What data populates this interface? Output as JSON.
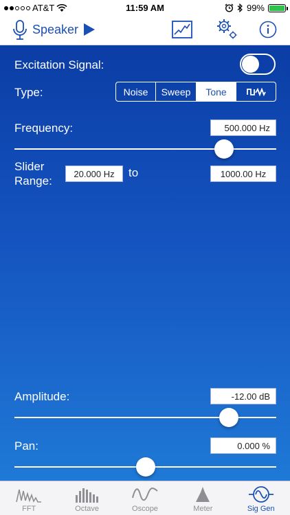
{
  "status_bar": {
    "carrier": "AT&T",
    "signal_dots_filled": 2,
    "signal_dots_total": 5,
    "time": "11:59 AM",
    "battery_percent_label": "99%",
    "battery_level": 0.99
  },
  "toolbar": {
    "input_label": "Speaker",
    "icons": [
      "microphone-icon",
      "play-icon",
      "chart-icon",
      "settings-icon",
      "info-icon"
    ]
  },
  "excitation": {
    "label": "Excitation Signal:",
    "enabled": false
  },
  "type": {
    "label": "Type:",
    "options": [
      "Noise",
      "Sweep",
      "Tone",
      "square-wave-icon"
    ],
    "selected": "Tone"
  },
  "frequency": {
    "label": "Frequency:",
    "value": "500.000 Hz",
    "slider_fraction": 0.8
  },
  "slider_range": {
    "label_line1": "Slider",
    "label_line2": "Range:",
    "min": "20.000 Hz",
    "to_label": "to",
    "max": "1000.00 Hz"
  },
  "amplitude": {
    "label": "Amplitude:",
    "value": "-12.00 dB",
    "slider_fraction": 0.82
  },
  "pan": {
    "label": "Pan:",
    "value": "0.000 %",
    "slider_fraction": 0.5
  },
  "tabs": [
    {
      "label": "FFT",
      "icon": "fft-icon",
      "active": false
    },
    {
      "label": "Octave",
      "icon": "octave-icon",
      "active": false
    },
    {
      "label": "Oscope",
      "icon": "oscope-icon",
      "active": false
    },
    {
      "label": "Meter",
      "icon": "meter-icon",
      "active": false
    },
    {
      "label": "Sig Gen",
      "icon": "sig-gen-icon",
      "active": true
    }
  ],
  "colors": {
    "accent": "#1a4fb4",
    "panel_top": "#0b3da5",
    "panel_bottom": "#1f79d6",
    "tab_inactive": "#8e8e93",
    "battery": "#2fc24d"
  }
}
